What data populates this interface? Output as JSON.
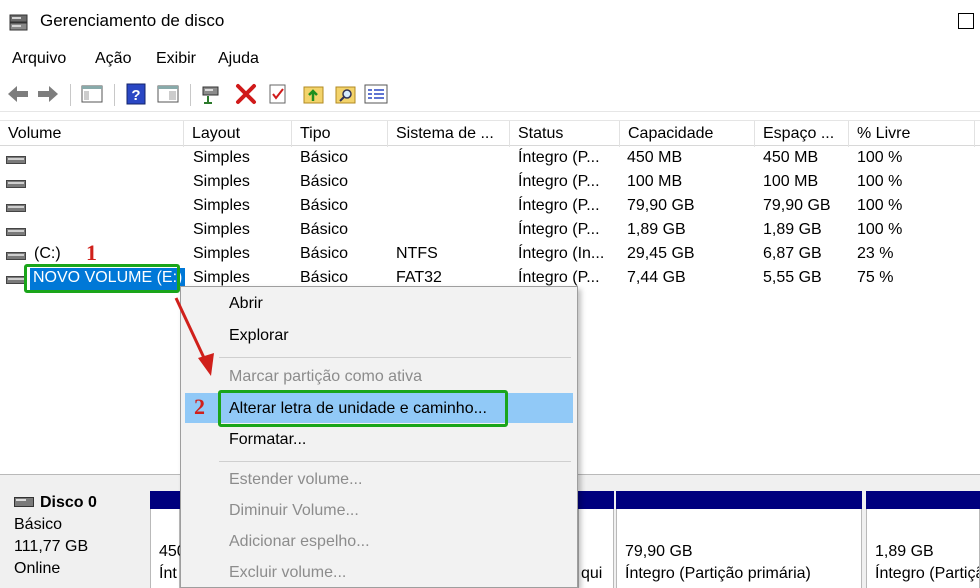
{
  "window": {
    "title": "Gerenciamento de disco"
  },
  "menu": [
    "Arquivo",
    "Ação",
    "Exibir",
    "Ajuda"
  ],
  "columns": [
    "Volume",
    "Layout",
    "Tipo",
    "Sistema de ...",
    "Status",
    "Capacidade",
    "Espaço ...",
    "% Livre"
  ],
  "rows": [
    {
      "volume": "",
      "layout": "Simples",
      "tipo": "Básico",
      "fs": "",
      "status": "Íntegro (P...",
      "cap": "450 MB",
      "free": "450 MB",
      "pct": "100 %"
    },
    {
      "volume": "",
      "layout": "Simples",
      "tipo": "Básico",
      "fs": "",
      "status": "Íntegro (P...",
      "cap": "100 MB",
      "free": "100 MB",
      "pct": "100 %"
    },
    {
      "volume": "",
      "layout": "Simples",
      "tipo": "Básico",
      "fs": "",
      "status": "Íntegro (P...",
      "cap": "79,90 GB",
      "free": "79,90 GB",
      "pct": "100 %"
    },
    {
      "volume": "",
      "layout": "Simples",
      "tipo": "Básico",
      "fs": "",
      "status": "Íntegro (P...",
      "cap": "1,89 GB",
      "free": "1,89 GB",
      "pct": "100 %"
    },
    {
      "volume": "(C:)",
      "layout": "Simples",
      "tipo": "Básico",
      "fs": "NTFS",
      "status": "Íntegro (In...",
      "cap": "29,45 GB",
      "free": "6,87 GB",
      "pct": "23 %"
    },
    {
      "volume": "NOVO VOLUME (E:)",
      "layout": "Simples",
      "tipo": "Básico",
      "fs": "FAT32",
      "status": "Íntegro (P...",
      "cap": "7,44 GB",
      "free": "5,55 GB",
      "pct": "75 %"
    }
  ],
  "disk": {
    "name": "Disco 0",
    "type": "Básico",
    "size": "111,77 GB",
    "state": "Online"
  },
  "partitions": [
    {
      "line1": "450",
      "line2": "Ínt"
    },
    {
      "line1": "",
      "line2": "qui"
    },
    {
      "line1": "79,90 GB",
      "line2": "Íntegro (Partição primária)"
    },
    {
      "line1": "1,89 GB",
      "line2": "Íntegro (Partição pri"
    }
  ],
  "context_menu": [
    {
      "label": "Abrir",
      "enabled": true
    },
    {
      "label": "Explorar",
      "enabled": true
    },
    {
      "label": "Marcar partição como ativa",
      "enabled": false
    },
    {
      "label": "Alterar letra de unidade e caminho...",
      "enabled": true,
      "highlighted": true
    },
    {
      "label": "Formatar...",
      "enabled": true
    },
    {
      "label": "Estender volume...",
      "enabled": false
    },
    {
      "label": "Diminuir Volume...",
      "enabled": false
    },
    {
      "label": "Adicionar espelho...",
      "enabled": false
    },
    {
      "label": "Excluir volume...",
      "enabled": false
    }
  ],
  "annotations": [
    "1",
    "2"
  ],
  "colors": {
    "selection": "#0078d7",
    "highlight": "#91c9f7",
    "annotation_box": "#1aa51a",
    "annotation_arrow": "#d0201b",
    "partition_bar": "#00007e"
  }
}
